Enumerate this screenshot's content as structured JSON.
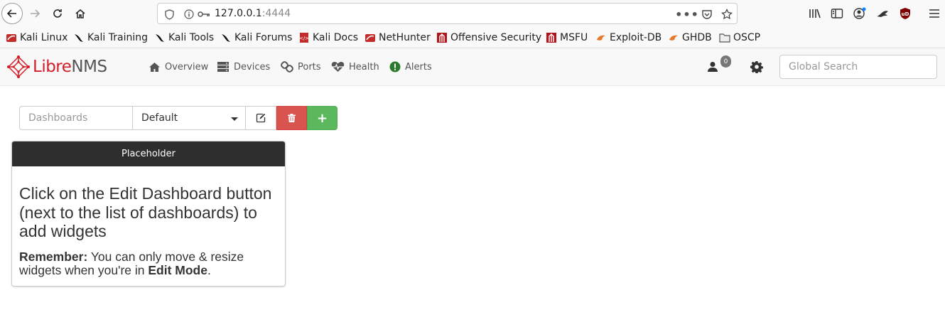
{
  "browser": {
    "url_host": "127.0.0.1",
    "url_port": ":4444"
  },
  "bookmarks": [
    {
      "label": "Kali Linux",
      "icon": "kali-icon"
    },
    {
      "label": "Kali Training",
      "icon": "kali-dragon-icon"
    },
    {
      "label": "Kali Tools",
      "icon": "kali-dragon-icon"
    },
    {
      "label": "Kali Forums",
      "icon": "kali-dragon-icon"
    },
    {
      "label": "Kali Docs",
      "icon": "kali-docs-icon"
    },
    {
      "label": "NetHunter",
      "icon": "kali-icon"
    },
    {
      "label": "Offensive Security",
      "icon": "offsec-icon"
    },
    {
      "label": "MSFU",
      "icon": "offsec-icon"
    },
    {
      "label": "Exploit-DB",
      "icon": "exploitdb-icon"
    },
    {
      "label": "GHDB",
      "icon": "exploitdb-icon"
    },
    {
      "label": "OSCP",
      "icon": "folder-icon"
    }
  ],
  "navbar": {
    "logo_libre": "Libre",
    "logo_nms": "NMS",
    "items": [
      {
        "label": "Overview",
        "icon": "home-icon"
      },
      {
        "label": "Devices",
        "icon": "server-icon"
      },
      {
        "label": "Ports",
        "icon": "link-icon"
      },
      {
        "label": "Health",
        "icon": "heartbeat-icon"
      },
      {
        "label": "Alerts",
        "icon": "exclamation-circle-icon"
      }
    ],
    "notification_count": "0",
    "search_placeholder": "Global Search"
  },
  "dashboard": {
    "addon_label": "Dashboards",
    "selected": "Default",
    "add_label": "+"
  },
  "widget": {
    "header": "Placeholder",
    "title": "Click on the Edit Dashboard button (next to the list of dashboards) to add widgets",
    "note_prefix": "Remember:",
    "note_mid": " You can only move & resize widgets when you're in ",
    "note_strong": "Edit Mode",
    "note_end": "."
  },
  "colors": {
    "accent_red": "#d9534f",
    "accent_green": "#5cb85c",
    "logo_red": "#d11e2a",
    "widget_header": "#2e2e2e"
  }
}
